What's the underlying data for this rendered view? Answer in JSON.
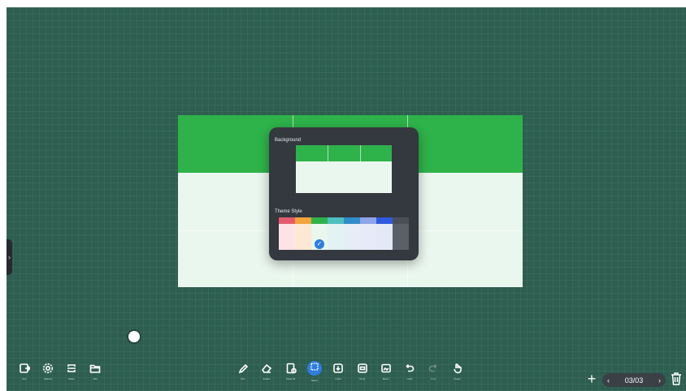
{
  "panel": {
    "background_title": "Background",
    "theme_title": "Theme Style",
    "swatches": [
      {
        "name": "red",
        "top": "#e55b6e",
        "bottom": "#fde2e6"
      },
      {
        "name": "orange",
        "top": "#f2a33a",
        "bottom": "#fde9d3"
      },
      {
        "name": "green",
        "top": "#2eb34a",
        "bottom": "#eaf7ee",
        "selected": true
      },
      {
        "name": "teal",
        "top": "#4dbfbf",
        "bottom": "#e3f2f3"
      },
      {
        "name": "blue",
        "top": "#2f8ec9",
        "bottom": "#e6edf4"
      },
      {
        "name": "periwinkle",
        "top": "#8fa3e8",
        "bottom": "#e7ebf7"
      },
      {
        "name": "royal-blue",
        "top": "#2f5be0",
        "bottom": "#e3e9f7"
      },
      {
        "name": "dark-gray",
        "top": "#4a4f56",
        "bottom": "#5a6068"
      }
    ]
  },
  "toolbar": {
    "left": [
      {
        "id": "exit",
        "label": "Exit",
        "icon": "exit-icon"
      },
      {
        "id": "options",
        "label": "Options",
        "icon": "gear-icon"
      },
      {
        "id": "share",
        "label": "Share",
        "icon": "share-icon"
      },
      {
        "id": "file",
        "label": "File",
        "icon": "folder-icon"
      }
    ],
    "center": [
      {
        "id": "pen",
        "label": "Pen",
        "icon": "pen-icon"
      },
      {
        "id": "eraser",
        "label": "Eraser",
        "icon": "eraser-icon"
      },
      {
        "id": "clear-all",
        "label": "Clear All",
        "icon": "clear-all-icon"
      },
      {
        "id": "select",
        "label": "Select",
        "icon": "select-icon",
        "active": true
      },
      {
        "id": "insert",
        "label": "Insert",
        "icon": "insert-icon"
      },
      {
        "id": "tools",
        "label": "Tools",
        "icon": "tools-icon"
      },
      {
        "id": "room",
        "label": "Room",
        "icon": "room-icon"
      },
      {
        "id": "undo",
        "label": "Undo",
        "icon": "undo-icon"
      },
      {
        "id": "redo",
        "label": "Redo",
        "icon": "redo-icon",
        "disabled": true
      },
      {
        "id": "finger",
        "label": "Finger",
        "icon": "hand-icon"
      }
    ]
  },
  "page_nav": {
    "current": "03/03",
    "prev": "‹",
    "next": "›",
    "add": "+"
  },
  "colors": {
    "canvas": "#2d5e50",
    "accent": "#2f7de1",
    "board_header": "#2eb34a",
    "board_body": "#eaf7ee",
    "panel": "#34383f"
  }
}
